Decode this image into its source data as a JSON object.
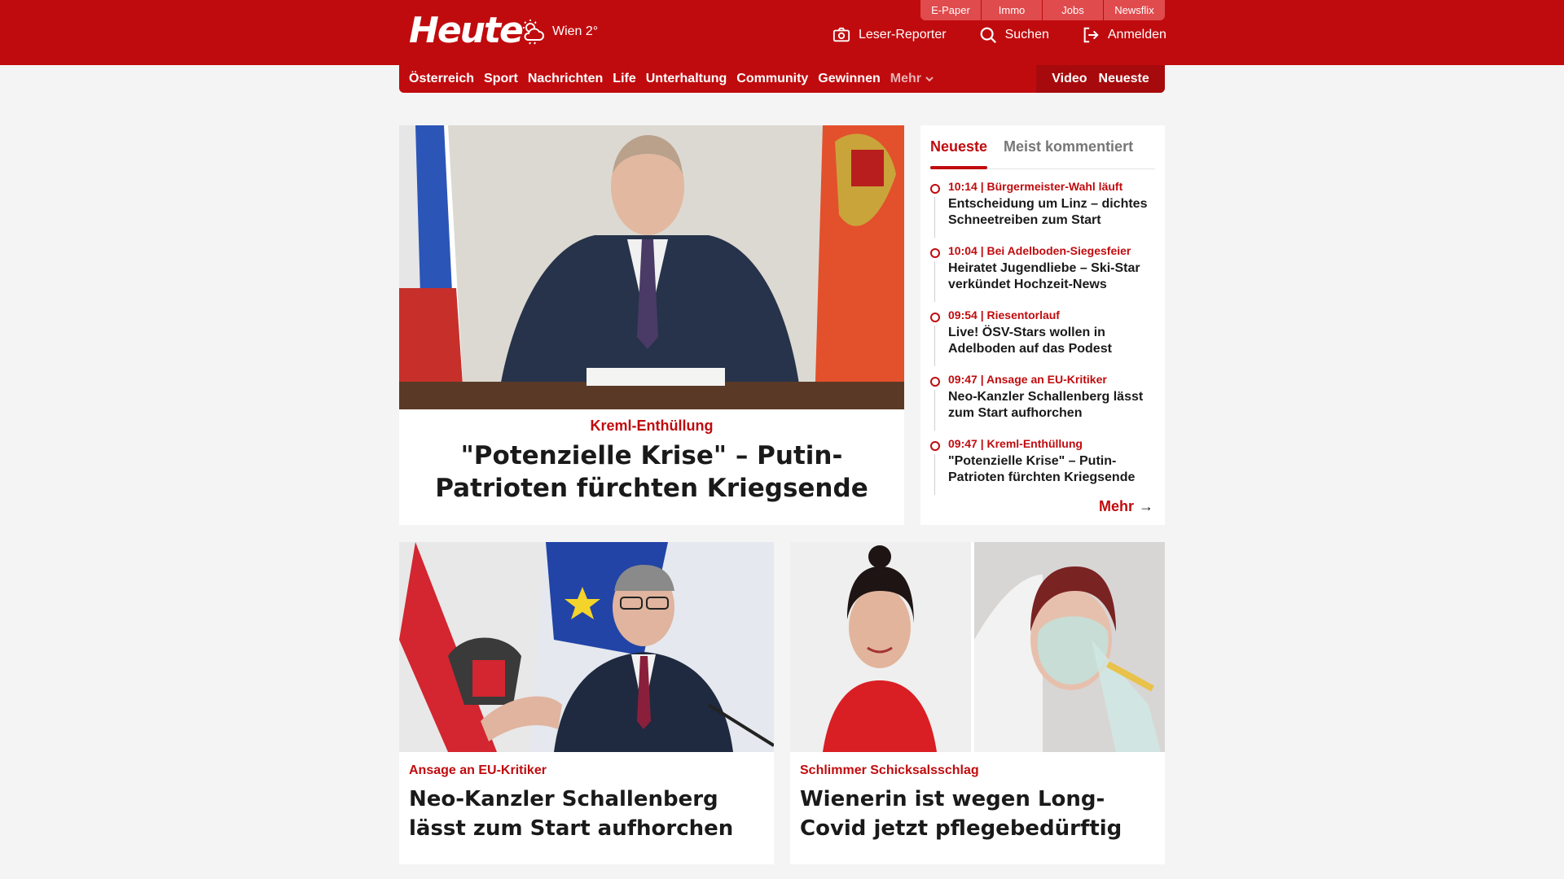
{
  "brand": {
    "logo": "Heute",
    "accent": "#c00b0e"
  },
  "top_links": [
    {
      "label": "E-Paper"
    },
    {
      "label": "Immo"
    },
    {
      "label": "Jobs"
    },
    {
      "label": "Newsflix"
    }
  ],
  "weather": {
    "location": "Wien 2°",
    "icon": "cloud-sun-icon"
  },
  "header_actions": {
    "reporter": "Leser-Reporter",
    "search": "Suchen",
    "login": "Anmelden"
  },
  "nav": {
    "items": [
      {
        "label": "Österreich"
      },
      {
        "label": "Sport"
      },
      {
        "label": "Nachrichten"
      },
      {
        "label": "Life"
      },
      {
        "label": "Unterhaltung"
      },
      {
        "label": "Community"
      },
      {
        "label": "Gewinnen"
      }
    ],
    "more": "Mehr",
    "video": "Video",
    "latest": "Neueste"
  },
  "hero": {
    "kicker": "Kreml-Enthüllung",
    "title": "\"Potenzielle Krise\" – Putin-Patrioten fürchten Kriegsende"
  },
  "sidebar": {
    "tabs": {
      "latest": "Neueste",
      "commented": "Meist kommentiert"
    },
    "items": [
      {
        "meta": "10:14 | Bürgermeister-Wahl läuft",
        "title": "Entscheidung um Linz – dichtes Schneetreiben zum Start"
      },
      {
        "meta": "10:04 | Bei Adelboden-Siegesfeier",
        "title": "Heiratet Jugendliebe – Ski-Star verkündet Hochzeit-News"
      },
      {
        "meta": "09:54 | Riesentorlauf",
        "title": "Live! ÖSV-Stars wollen in Adelboden auf das Podest"
      },
      {
        "meta": "09:47 | Ansage an EU-Kritiker",
        "title": "Neo-Kanzler Schallenberg lässt zum Start aufhorchen"
      },
      {
        "meta": "09:47 | Kreml-Enthüllung",
        "title": "\"Potenzielle Krise\" – Putin-Patrioten fürchten Kriegsende"
      }
    ],
    "more": "Mehr"
  },
  "cards": [
    {
      "kicker": "Ansage an EU-Kritiker",
      "title": "Neo-Kanzler Schallenberg lässt zum Start aufhorchen"
    },
    {
      "kicker": "Schlimmer Schicksalsschlag",
      "title": "Wienerin ist wegen Long-Covid jetzt pflegebedürftig"
    }
  ]
}
